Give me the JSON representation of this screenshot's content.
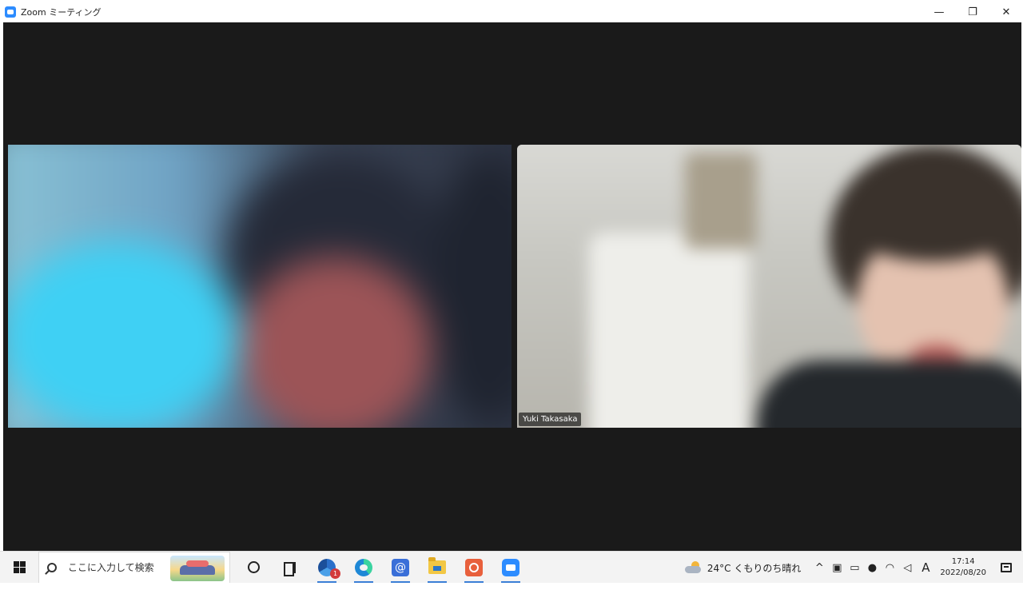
{
  "window": {
    "title": "Zoom ミーティング",
    "controls": {
      "minimize": "—",
      "restore": "❐",
      "close": "✕"
    }
  },
  "meeting": {
    "participants": [
      {
        "name": "",
        "video": "blurred"
      },
      {
        "name": "Yuki Takasaka",
        "video": "camera"
      }
    ]
  },
  "taskbar": {
    "search_placeholder": "ここに入力して検索",
    "apps": [
      {
        "icon": "cortana-icon"
      },
      {
        "icon": "task-view-icon"
      },
      {
        "icon": "chrome-icon",
        "badge": "1"
      },
      {
        "icon": "edge-icon"
      },
      {
        "icon": "mail-icon",
        "glyph": "@"
      },
      {
        "icon": "file-explorer-icon"
      },
      {
        "icon": "app-icon"
      },
      {
        "icon": "zoom-icon"
      }
    ],
    "tray": {
      "weather": "24°C くもりのち晴れ",
      "chevron": "^",
      "ime": "A",
      "time": "17:14",
      "date": "2022/08/20"
    }
  }
}
